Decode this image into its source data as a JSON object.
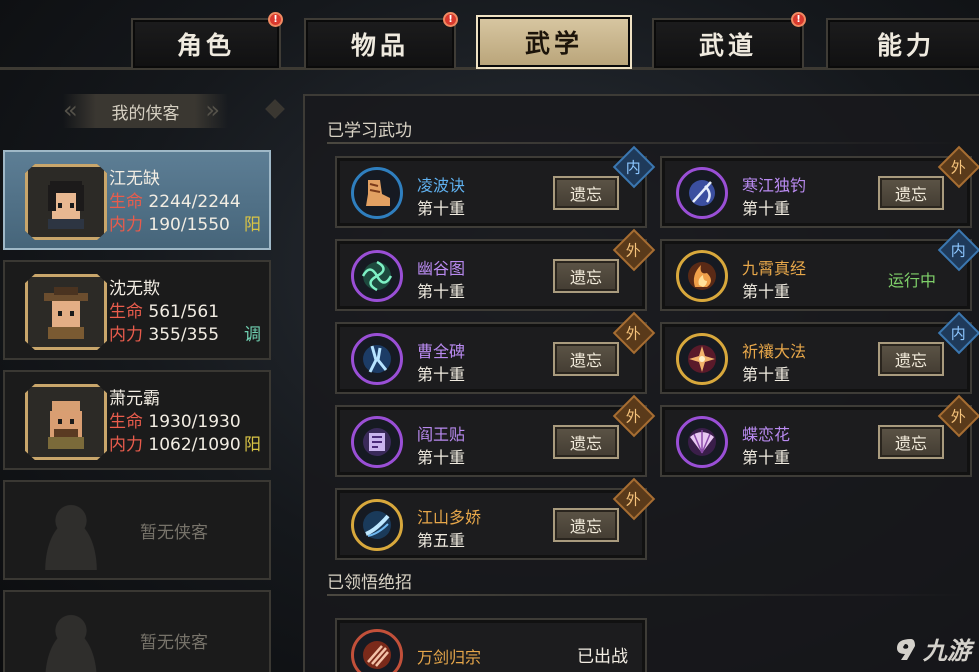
{
  "tabs": [
    {
      "label": "角色",
      "alert": true,
      "active": false
    },
    {
      "label": "物品",
      "alert": true,
      "active": false
    },
    {
      "label": "武学",
      "alert": false,
      "active": true
    },
    {
      "label": "武道",
      "alert": true,
      "active": false
    },
    {
      "label": "能力",
      "alert": false,
      "active": false
    }
  ],
  "alert_glyph": "!",
  "sidebar": {
    "title": "我的侠客",
    "heroes": [
      {
        "name": "江无缺",
        "hp_label": "生命",
        "hp": "2244/2244",
        "mp_label": "内力",
        "mp": "190/1550",
        "tag": "阳",
        "tag_color": "#d9c445"
      },
      {
        "name": "沈无欺",
        "hp_label": "生命",
        "hp": "561/561",
        "mp_label": "内力",
        "mp": "355/355",
        "tag": "调",
        "tag_color": "#6fcfb0"
      },
      {
        "name": "萧元霸",
        "hp_label": "生命",
        "hp": "1930/1930",
        "mp_label": "内力",
        "mp": "1062/1090",
        "tag": "阳",
        "tag_color": "#d9c445"
      }
    ],
    "empty_label": "暂无侠客"
  },
  "main": {
    "learned_title": "已学习武功",
    "learned": [
      {
        "name": "凌波诀",
        "level": "第十重",
        "action": "遗忘",
        "badge": "内",
        "badge_type": "nei",
        "name_color": "c-blue",
        "icon": "boot-icon",
        "ring": "blue"
      },
      {
        "name": "寒江独钓",
        "level": "第十重",
        "action": "遗忘",
        "badge": "外",
        "badge_type": "wai",
        "name_color": "c-purple",
        "icon": "fishing-icon",
        "ring": "purple"
      },
      {
        "name": "幽谷图",
        "level": "第十重",
        "action": "遗忘",
        "badge": "外",
        "badge_type": "wai",
        "name_color": "c-purple",
        "icon": "vortex-icon",
        "ring": "purple"
      },
      {
        "name": "九霄真经",
        "level": "第十重",
        "action": "运行中",
        "badge": "内",
        "badge_type": "nei",
        "name_color": "c-orange",
        "icon": "flame-icon",
        "ring": "gold"
      },
      {
        "name": "曹全碑",
        "level": "第十重",
        "action": "遗忘",
        "badge": "外",
        "badge_type": "wai",
        "name_color": "c-purple",
        "icon": "shard-icon",
        "ring": "purple"
      },
      {
        "name": "祈禳大法",
        "level": "第十重",
        "action": "遗忘",
        "badge": "内",
        "badge_type": "nei",
        "name_color": "c-orange",
        "icon": "star-icon",
        "ring": "gold"
      },
      {
        "name": "阎王贴",
        "level": "第十重",
        "action": "遗忘",
        "badge": "外",
        "badge_type": "wai",
        "name_color": "c-purple",
        "icon": "seal-icon",
        "ring": "purple"
      },
      {
        "name": "蝶恋花",
        "level": "第十重",
        "action": "遗忘",
        "badge": "外",
        "badge_type": "wai",
        "name_color": "c-purple",
        "icon": "fan-icon",
        "ring": "purple"
      },
      {
        "name": "江山多娇",
        "level": "第五重",
        "action": "遗忘",
        "badge": "外",
        "badge_type": "wai",
        "name_color": "c-orange",
        "icon": "sword-slash-icon",
        "ring": "gold"
      }
    ],
    "ultimate_title": "已领悟绝招",
    "ultimate": {
      "name": "万剑归宗",
      "status": "已出战",
      "icon": "swords-icon"
    }
  },
  "watermark": "九游"
}
